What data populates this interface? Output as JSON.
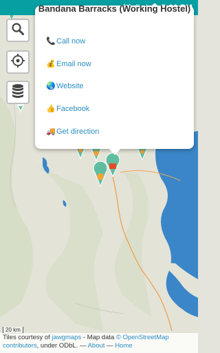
{
  "status_bar": {
    "time": "5:30 PM",
    "network": "4G",
    "icons": [
      "alarm-icon",
      "signal-icon",
      "battery-icon"
    ]
  },
  "map_controls": {
    "search_icon": "search-icon",
    "locate_icon": "crosshair-icon",
    "layers_icon": "database-icon"
  },
  "popup": {
    "title": "Bandana Barracks (Working Hostel)",
    "items": [
      {
        "emoji": "📞",
        "label": "Call now"
      },
      {
        "emoji": "💰",
        "label": "Email now"
      },
      {
        "emoji": "🌏",
        "label": "Website"
      },
      {
        "emoji": "👍",
        "label": "Facebook"
      },
      {
        "emoji": "🚚",
        "label": "Get direction"
      }
    ]
  },
  "attribution": {
    "prefix": "Tiles courtesy of ",
    "tiles_link": "jawgmaps",
    "middle": " - Map data ",
    "data_link": "© OpenStreetMap contributors",
    "suffix": ", under ODbL. — ",
    "about_link": "About",
    "sep": " — ",
    "home_link": "Home"
  },
  "scale_label": "20 km",
  "colors": {
    "accent": "#06a0a3",
    "link": "#2b8fc4",
    "marker": "#5fbe9f",
    "water": "#3a86c8"
  }
}
